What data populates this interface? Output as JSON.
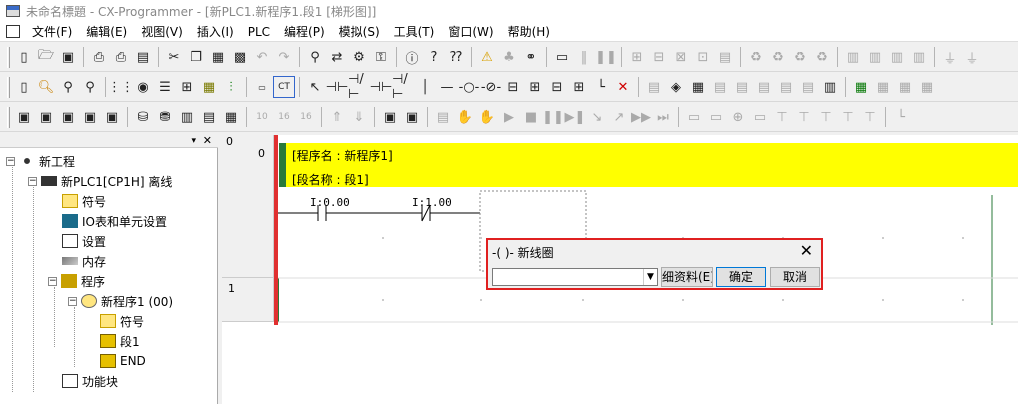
{
  "window": {
    "title": "未命名標題 - CX-Programmer - [新PLC1.新程序1.段1 [梯形图]]"
  },
  "menu": [
    "文件(F)",
    "编辑(E)",
    "视图(V)",
    "插入(I)",
    "PLC",
    "编程(P)",
    "模拟(S)",
    "工具(T)",
    "窗口(W)",
    "帮助(H)"
  ],
  "toolbar1": [
    "new-file",
    "open-folder",
    "save",
    "print-preview",
    "print",
    "preview",
    "cut",
    "copy",
    "paste",
    "clipboard",
    "undo",
    "redo",
    "find",
    "replace",
    "transfer",
    "find-replace",
    "info",
    "help",
    "context-help",
    "warning",
    "online",
    "transfer-from",
    "transfer-to",
    "compare",
    "monitor",
    "pause",
    "step",
    "run",
    "force-on",
    "force-off",
    "compile",
    "memory",
    "data-trace",
    "time-chart",
    "mem-a",
    "mem-b",
    "mem-c",
    "mem-d",
    "io-table",
    "io-b",
    "io-c",
    "io-d",
    "io-e",
    "io-f"
  ],
  "toolbar2": [
    "new-doc",
    "zoom-in",
    "zoom-reset",
    "zoom-out",
    "grid",
    "watch",
    "list",
    "rung-comment",
    "ladder",
    "symbol",
    "show-comments",
    "cross-ref",
    "select",
    "contact-no",
    "contact-nc",
    "or-no",
    "or-nc",
    "vertical",
    "horizontal",
    "coil",
    "coil-nc",
    "instruction",
    "pin",
    "bit",
    "jump",
    "delete-line",
    "network-a",
    "network-b",
    "network-c",
    "network-d",
    "network-e",
    "network-f",
    "network-g",
    "network-h",
    "network-i",
    "network-j",
    "network-k",
    "network-l"
  ],
  "toolbar3": [
    "view-project",
    "view-output",
    "view-watch",
    "view-address",
    "properties",
    "cross-ref",
    "symbol-table",
    "chart",
    "list-view",
    "num-10",
    "num-16",
    "num-16b",
    "up",
    "down",
    "monitor",
    "diff-monitor",
    "task",
    "stop",
    "run-step",
    "pause",
    "step-in",
    "step-out",
    "step-over",
    "fast",
    "end",
    "func-a",
    "func-b",
    "func-c",
    "func-d",
    "func-e",
    "func-f",
    "func-g",
    "func-h",
    "func-i"
  ],
  "tree": {
    "project": "新工程",
    "plc": "新PLC1[CP1H] 离线",
    "symbols": "符号",
    "io_table": "IO表和单元设置",
    "settings": "设置",
    "memory": "内存",
    "programs": "程序",
    "program1": "新程序1 (00)",
    "prog_symbols": "符号",
    "section1": "段1",
    "end": "END",
    "function_blocks": "功能块"
  },
  "ladder": {
    "row0_top": "0",
    "row0_step": "0",
    "row1": "1",
    "program_name_line": "[程序名 : 新程序1]",
    "section_name_line": "[段名称 : 段1]",
    "contact1_addr": "I:0.00",
    "contact2_addr": "I:1.00"
  },
  "dialog": {
    "title": "-( )- 新线圈",
    "close": "✕",
    "input_value": "",
    "detail_button": "细资料(E)",
    "ok_button": "确定",
    "cancel_button": "取消"
  },
  "colors": {
    "accent": "#e02020",
    "comment_bg": "#ffff00",
    "section_bar": "#2a7a3a"
  }
}
